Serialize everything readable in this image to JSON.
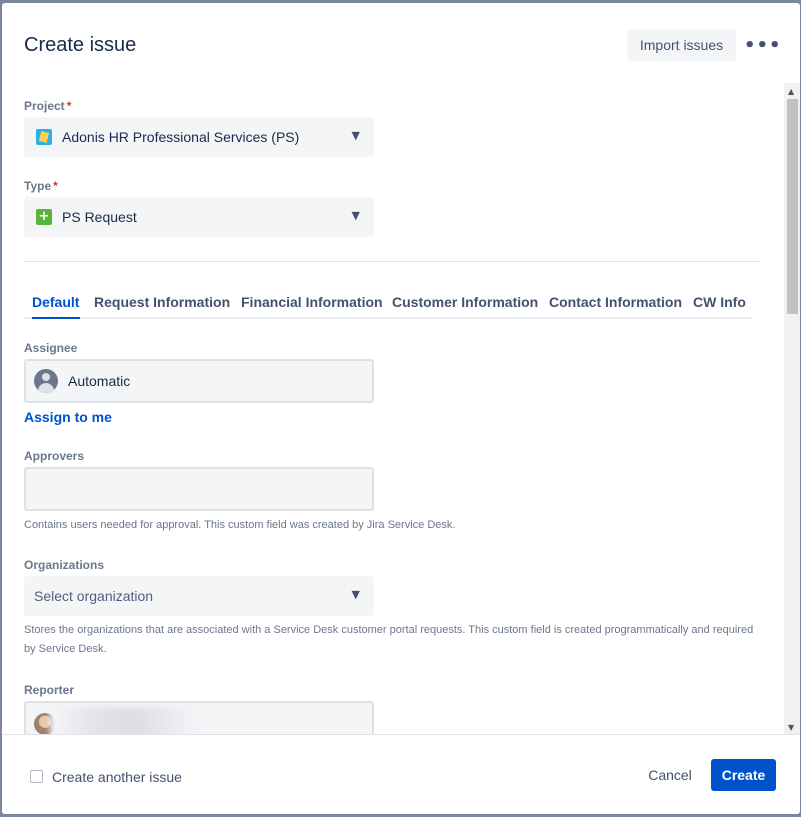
{
  "header": {
    "title": "Create issue",
    "import_label": "Import issues",
    "more_label": "•••"
  },
  "project": {
    "label": "Project",
    "required": "*",
    "value": "Adonis HR Professional Services (PS)",
    "icon": "project-icon"
  },
  "type": {
    "label": "Type",
    "required": "*",
    "value": "PS Request",
    "icon": "plus-square-icon"
  },
  "tabs": [
    {
      "label": "Default",
      "active": true
    },
    {
      "label": "Request Information"
    },
    {
      "label": "Financial Information"
    },
    {
      "label": "Customer Information"
    },
    {
      "label": "Contact Information"
    },
    {
      "label": "CW Info"
    }
  ],
  "assignee": {
    "label": "Assignee",
    "value": "Automatic",
    "assign_to_me": "Assign to me"
  },
  "approvers": {
    "label": "Approvers",
    "value": "",
    "help": "Contains users needed for approval. This custom field was created by Jira Service Desk."
  },
  "organizations": {
    "label": "Organizations",
    "placeholder": "Select organization",
    "help": "Stores the organizations that are associated with a Service Desk customer portal requests. This custom field is created programmatically and required by Service Desk."
  },
  "reporter": {
    "label": "Reporter"
  },
  "footer": {
    "create_another_label": "Create another issue",
    "cancel_label": "Cancel",
    "create_label": "Create"
  },
  "colors": {
    "primary": "#0052cc",
    "required": "#de350b",
    "field_bg": "#f4f5f7"
  }
}
